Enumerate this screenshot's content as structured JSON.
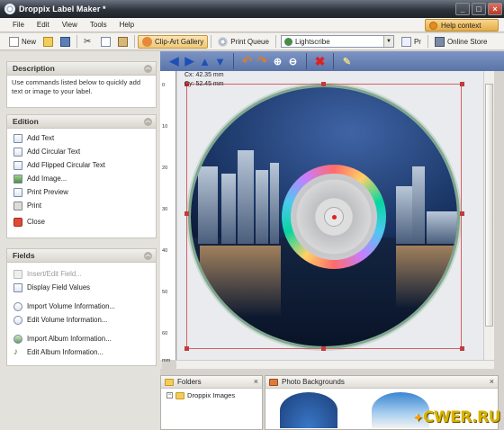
{
  "window": {
    "title": "Droppix Label Maker *",
    "min": "_",
    "max": "□",
    "close": "×"
  },
  "menu": {
    "items": [
      "File",
      "Edit",
      "View",
      "Tools",
      "Help"
    ],
    "help_context": "Help context"
  },
  "toolbar": {
    "new": "New",
    "clip_art": "Clip-Art Gallery",
    "print_queue": "Print Queue",
    "printer_select": "Lightscribe",
    "pr_truncated": "Pr",
    "online_store": "Online Store"
  },
  "description": {
    "header": "Description",
    "text": "Use commands listed below to quickly add text or image to your label."
  },
  "edition": {
    "header": "Edition",
    "items": [
      "Add Text",
      "Add Circular Text",
      "Add Flipped Circular Text",
      "Add Image...",
      "Print Preview",
      "Print",
      "Close"
    ]
  },
  "fields": {
    "header": "Fields",
    "items": [
      "Insert/Edit Field...",
      "Display Field Values",
      "Import Volume Information...",
      "Edit Volume Information...",
      "Import Album Information...",
      "Edit Album Information..."
    ]
  },
  "canvas": {
    "cx": "Cx:",
    "cx_value": "42.35 mm",
    "cy": "Cy:",
    "cy_value": "52.45 mm",
    "ruler_ticks": [
      "0",
      "10",
      "20",
      "30",
      "40",
      "50",
      "60"
    ],
    "ruler_unit": "mm"
  },
  "folders": {
    "header": "Folders",
    "tree_item": "Droppix Images"
  },
  "backgrounds": {
    "header": "Photo Backgrounds"
  },
  "watermark": {
    "text": "CWER.RU"
  },
  "colors": {
    "accent_toolbar": "#5a74a8",
    "selection_rect": "#d56262",
    "cd_ring": "#7fa78f"
  }
}
